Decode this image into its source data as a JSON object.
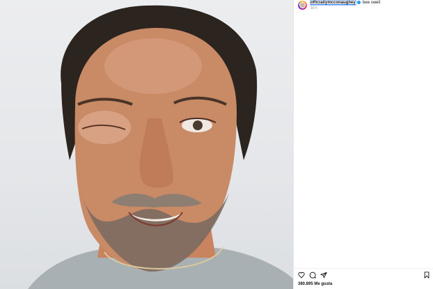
{
  "post": {
    "username": "officiallymcconaughey",
    "caption": "bee swell",
    "time": "16 h",
    "likes": "380.895 Me gusta"
  },
  "icons": {
    "like": "heart-icon",
    "comment": "comment-icon",
    "share": "share-icon",
    "save": "bookmark-icon",
    "verified": "verified-badge-icon"
  },
  "colors": {
    "verified": "#1d9bf0",
    "text": "#111111",
    "muted": "#8e8e8e"
  }
}
